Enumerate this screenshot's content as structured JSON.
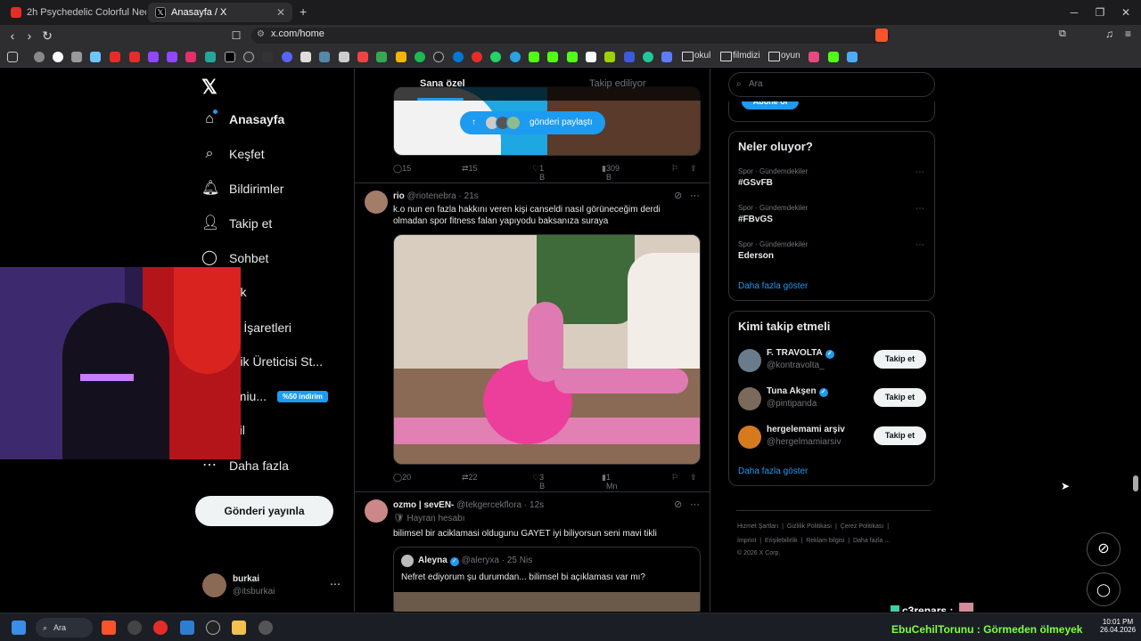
{
  "browser": {
    "tabs": [
      {
        "title": "2h Psychedelic Colorful Neon Backgr"
      },
      {
        "title": "Anasayfa / X"
      }
    ],
    "new_tab": "+",
    "url": "x.com/home",
    "bookmarks": [
      "okul",
      "filmdizi",
      "oyun"
    ]
  },
  "nav": {
    "items": [
      {
        "label": "Anasayfa",
        "icon": "home-icon"
      },
      {
        "label": "Keşfet",
        "icon": "search-icon"
      },
      {
        "label": "Bildirimler",
        "icon": "bell-icon"
      },
      {
        "label": "Takip et",
        "icon": "add-user-icon"
      },
      {
        "label": "Sohbet",
        "icon": "chat-icon"
      },
      {
        "label": "rok",
        "icon": "grok-icon"
      },
      {
        "label": "er İşaretleri",
        "icon": "bookmark-icon"
      },
      {
        "label": "erik Üreticisi St...",
        "icon": "creator-icon"
      },
      {
        "label": "emiu...",
        "icon": "premium-icon"
      },
      {
        "label": "ofil",
        "icon": "profile-icon"
      },
      {
        "label": "Daha fazla",
        "icon": "more-circle-icon"
      }
    ],
    "premium_badge": "%50 indirim",
    "post_button": "Gönderi yayınla",
    "account": {
      "name": "burkai",
      "handle": "@itsburkai"
    }
  },
  "feed": {
    "tabs": [
      "Sana özel",
      "Takip ediliyor"
    ],
    "share_pill": "gönderi paylaştı",
    "post1_stats": {
      "replies": "15",
      "reposts": "15",
      "likes": "1 B",
      "views": "309 B"
    },
    "post2": {
      "name": "rio",
      "handle": "@riotenebra",
      "time": "21s",
      "text": "k.o nun en fazla hakkını veren kişi canseldi nasıl görüneceğim derdi olmadan spor fitness falan yapıyodu baksanıza suraya",
      "stats": {
        "replies": "20",
        "reposts": "22",
        "likes": "3 B",
        "views": "1 Mn"
      }
    },
    "post3": {
      "name": "ozmo | sevEN-",
      "handle": "@tekgercekflora",
      "time": "12s",
      "badge": "Hayran hesabı",
      "text": "bilimsel bir aciklamasi oldugunu GAYET iyi biliyorsun seni mavi tikli",
      "quote": {
        "name": "Aleyna",
        "handle": "@aleryxa",
        "date": "25 Nis",
        "text": "Nefret ediyorum şu durumdan... bilimsel bi açıklaması var mı?"
      }
    }
  },
  "right": {
    "search_placeholder": "Ara",
    "subscribe_button": "Abone ol",
    "trends_title": "Neler oluyor?",
    "trends": [
      {
        "category": "Spor · Gündemdekiler",
        "name": "#GSvFB"
      },
      {
        "category": "Spor · Gündemdekiler",
        "name": "#FBvGS"
      },
      {
        "category": "Spor · Gündemdekiler",
        "name": "Ederson"
      }
    ],
    "show_more": "Daha fazla göster",
    "wtf_title": "Kimi takip etmeli",
    "wtf": [
      {
        "name": "F. TRAVOLTA",
        "handle": "@kontravolta_",
        "verified": true
      },
      {
        "name": "Tuna Akşen",
        "handle": "@pintipanda",
        "verified": true
      },
      {
        "name": "hergelemami arşiv",
        "handle": "@hergelmamiarsiv",
        "verified": false
      }
    ],
    "follow_label": "Takip et",
    "footer": [
      "Hizmet Şartları",
      "Gizlilik Politikası",
      "Çerez Politikası",
      "İmprint",
      "Erişilebilirlik",
      "Reklam bilgisi",
      "Daha fazla ...",
      "© 2026 X Corp."
    ]
  },
  "stream_overlay": {
    "chat1_user": "c3renars :",
    "chat2": "EbuCehilTorunu : Görmeden ölmeyek"
  },
  "taskbar": {
    "search_label": "Ara",
    "time": "10:01 PM",
    "date": "26.04.2026"
  }
}
